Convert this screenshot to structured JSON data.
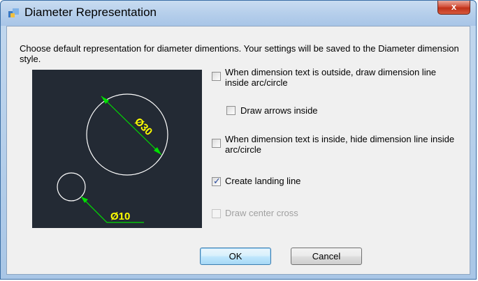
{
  "window": {
    "title": "Diameter Representation",
    "close_label": "x"
  },
  "description": "Choose default representation for diameter dimentions.  Your settings will be saved to the Diameter dimension style.",
  "preview": {
    "large_label": "Ø30",
    "small_label": "Ø10",
    "line_color": "#00e000",
    "text_color": "#ffff00",
    "circle_color": "#ffffff"
  },
  "options": [
    {
      "label": "When dimension text is outside, draw dimension line inside arc/circle",
      "checked": false,
      "enabled": true
    },
    {
      "label": "Draw arrows inside",
      "checked": false,
      "enabled": true
    },
    {
      "label": "When dimension text is inside, hide dimension line inside arc/circle",
      "checked": false,
      "enabled": true
    },
    {
      "label": "Create landing line",
      "checked": true,
      "enabled": true
    },
    {
      "label": "Draw center cross",
      "checked": false,
      "enabled": false
    }
  ],
  "buttons": {
    "ok": "OK",
    "cancel": "Cancel"
  }
}
